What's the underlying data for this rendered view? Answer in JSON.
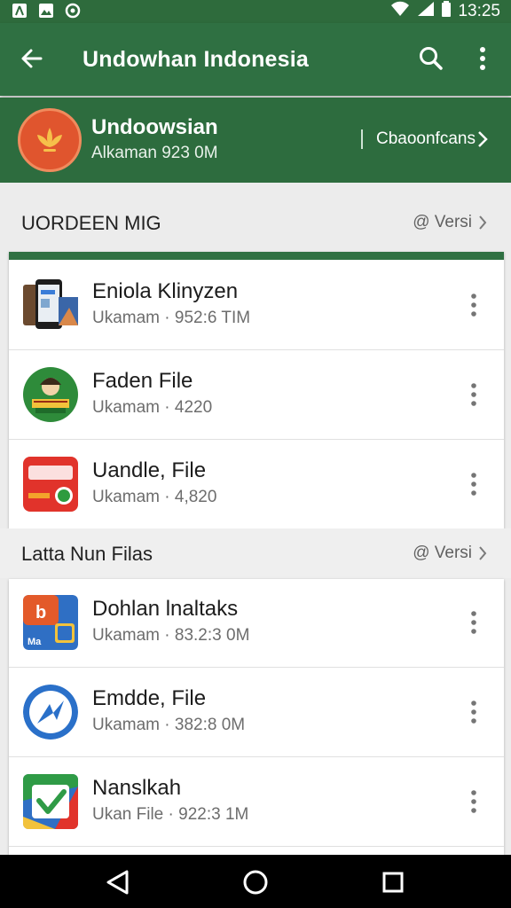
{
  "status_bar": {
    "time": "13:25"
  },
  "app_bar": {
    "title": "Undowhan Indonesia"
  },
  "profile": {
    "name": "Undoowsian",
    "subtitle": "Alkaman 923 0M",
    "link_label": "Cbaoonfcans"
  },
  "section1": {
    "title": "UORDEEN MIG",
    "action_label": "@ Versi",
    "items": [
      {
        "name": "Eniola Klinyzen",
        "meta": "Ukamam · 952:6 TIM"
      },
      {
        "name": "Faden File",
        "meta": "Ukamam · 4220"
      },
      {
        "name": "Uandle, File",
        "meta": "Ukamam · 4,820"
      }
    ]
  },
  "section2": {
    "title": "Latta Nun Filas",
    "action_label": "@ Versi",
    "items": [
      {
        "name": "Dohlan lnaltaks",
        "meta": "Ukamam · 83.2:3 0M"
      },
      {
        "name": "Emdde, File",
        "meta": "Ukamam · 382:8 0M"
      },
      {
        "name": "Nanslkah",
        "meta": "Ukan File · 922:3 1M"
      }
    ]
  },
  "icons": {
    "back": "arrow-left-icon",
    "search": "search-icon",
    "more": "more-vertical-icon",
    "nav_back": "triangle-back-icon",
    "nav_home": "circle-home-icon",
    "nav_recents": "square-recents-icon"
  },
  "colors": {
    "primary": "#2f7042",
    "primary_dark": "#2e6b3c",
    "avatar": "#e0552e"
  }
}
